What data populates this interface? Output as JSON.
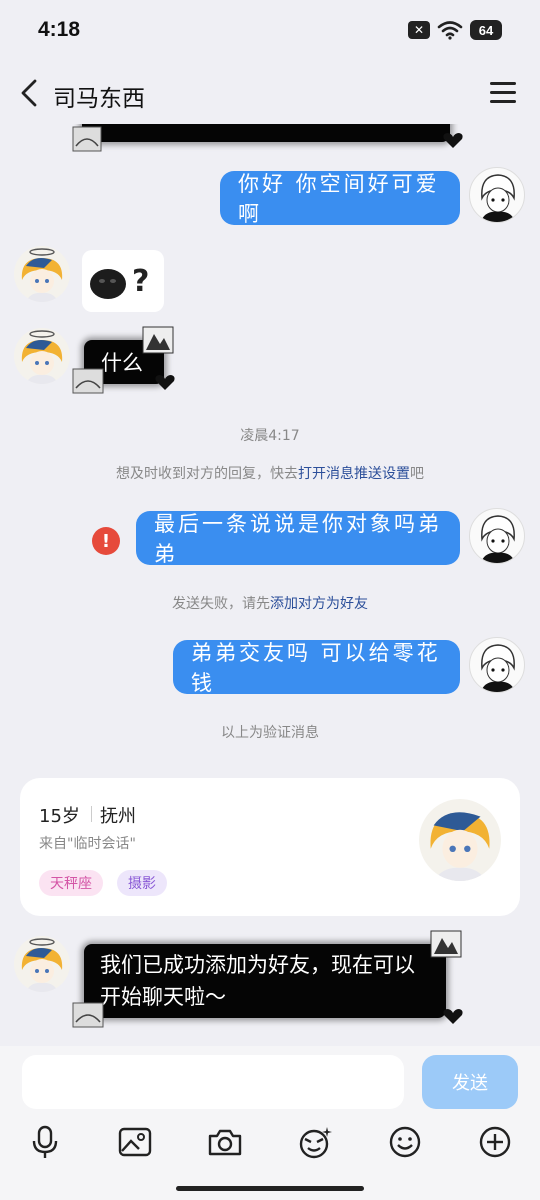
{
  "status_bar": {
    "time": "4:18",
    "x_badge": "✕",
    "battery": "64"
  },
  "header": {
    "title": "司马东西"
  },
  "messages": {
    "m1": "你好 你空间好可爱啊",
    "m2_sticker_glyph": "?",
    "m3": "什么",
    "timestamp": "凌晨4:17",
    "notice_prefix": "想及时收到对方的回复，快去",
    "notice_link": "打开消息推送设置",
    "notice_suffix": "吧",
    "m4": "最后一条说说是你对象吗弟弟",
    "fail_icon": "!",
    "fail_prefix": "发送失败，请先",
    "fail_link": "添加对方为好友",
    "m5": "弟弟交友吗 可以给零花钱",
    "verify_divider": "以上为验证消息",
    "m6": "我们已成功添加为好友，现在可以开始聊天啦～"
  },
  "profile_card": {
    "age": "15岁",
    "city": "抚州",
    "source": "来自\"临时会话\"",
    "tags": [
      "天秤座",
      "摄影"
    ]
  },
  "input_bar": {
    "placeholder": "",
    "send_label": "发送"
  },
  "icons": [
    "back-icon",
    "menu-icon",
    "microphone-icon",
    "image-icon",
    "camera-icon",
    "sticker-icon",
    "emoji-icon",
    "plus-icon"
  ],
  "colors": {
    "bubble_blue": "#3a8ef0",
    "link": "#2c4f9a",
    "fail_red": "#e64a3b",
    "send_disabled": "#9ccaf8"
  }
}
